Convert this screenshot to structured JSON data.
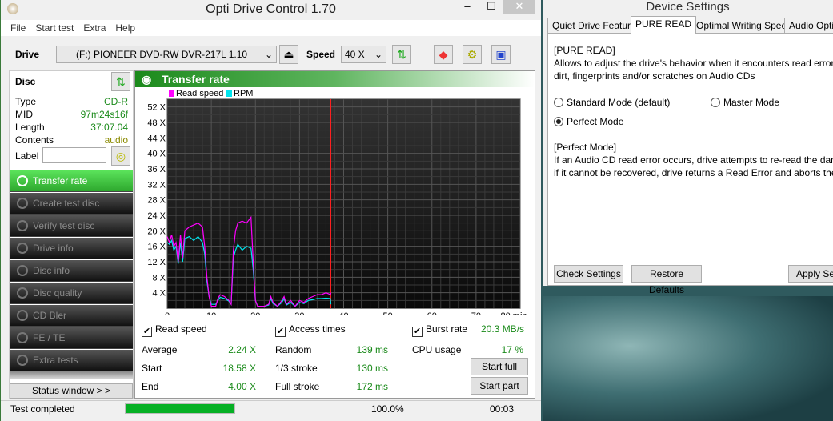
{
  "window": {
    "title": "Opti Drive Control 1.70",
    "minimize": "–",
    "maximize": "☐",
    "close": "✕"
  },
  "menu": [
    "File",
    "Start test",
    "Extra",
    "Help"
  ],
  "toolbar": {
    "drive_label": "Drive",
    "drive_value": "(F:)   PIONEER DVD-RW  DVR-217L 1.10",
    "speed_label": "Speed",
    "speed_value": "40 X"
  },
  "disc": {
    "title": "Disc",
    "fields": [
      {
        "k": "Type",
        "v": "CD-R"
      },
      {
        "k": "MID",
        "v": "97m24s16f"
      },
      {
        "k": "Length",
        "v": "37:07.04"
      },
      {
        "k": "Contents",
        "v": "audio"
      }
    ],
    "label_label": "Label",
    "label_value": ""
  },
  "nav": [
    "Transfer rate",
    "Create test disc",
    "Verify test disc",
    "Drive info",
    "Disc info",
    "Disc quality",
    "CD Bler",
    "FE / TE",
    "Extra tests"
  ],
  "status_window": "Status window > >",
  "panel_title": "Transfer rate",
  "chart_data": {
    "type": "line",
    "xlabel": "min",
    "xlim": [
      0,
      80
    ],
    "ylim": [
      0,
      54
    ],
    "xticks": [
      "0",
      "10",
      "20",
      "30",
      "40",
      "50",
      "60",
      "70",
      "80 min"
    ],
    "yticks": [
      "4 X",
      "8 X",
      "12 X",
      "16 X",
      "20 X",
      "24 X",
      "28 X",
      "32 X",
      "36 X",
      "40 X",
      "44 X",
      "48 X",
      "52 X"
    ],
    "grid": true,
    "legend": "top-left",
    "marker_line_x": 37.1,
    "colors": {
      "Read speed": "#ff00ff",
      "RPM": "#00e5ee",
      "marker": "#ff2020",
      "bg": "#1a1a1a"
    },
    "series": [
      {
        "name": "Read speed",
        "x": [
          0,
          0.5,
          1,
          1.5,
          2,
          2.5,
          3,
          3.5,
          4,
          5,
          6,
          7,
          8,
          8.5,
          9,
          9.5,
          10,
          11,
          11.5,
          12,
          13,
          14,
          14.5,
          15,
          15.5,
          16,
          17,
          18,
          19,
          19.5,
          20,
          20.5,
          22,
          23,
          23.5,
          24,
          25,
          26,
          26.5,
          27,
          28,
          29,
          30,
          31,
          32,
          33,
          34,
          35,
          36,
          37,
          37.1
        ],
        "values": [
          18.5,
          17,
          19,
          16,
          17,
          12,
          19,
          13,
          20,
          21,
          21.5,
          22,
          21,
          16,
          8,
          3,
          0.5,
          0.5,
          2.5,
          3.5,
          3,
          2,
          1,
          15,
          20,
          22,
          22.5,
          22,
          23.5,
          12,
          2,
          0.5,
          0.5,
          1,
          3,
          1.5,
          0.5,
          2,
          3,
          1,
          2,
          0.5,
          2,
          1.5,
          2.5,
          3,
          3.5,
          3.5,
          4,
          3.5,
          4
        ]
      },
      {
        "name": "RPM",
        "x": [
          0,
          0.5,
          1,
          1.5,
          2,
          2.5,
          3,
          3.5,
          4,
          5,
          6,
          7,
          8,
          8.5,
          9,
          9.5,
          10,
          11,
          11.5,
          12,
          13,
          14,
          14.5,
          15,
          15.5,
          16,
          17,
          18,
          19,
          19.5,
          20,
          20.5,
          22,
          23,
          23.5,
          24,
          25,
          26,
          26.5,
          27,
          28,
          29,
          30,
          31,
          32,
          33,
          34,
          35,
          36,
          37,
          37.1
        ],
        "values": [
          17,
          16.5,
          17.5,
          15,
          16,
          11.5,
          17,
          12,
          18,
          18.5,
          17.5,
          18.5,
          17,
          14,
          7,
          3,
          1,
          1,
          2,
          2.8,
          2.5,
          1.8,
          1,
          13,
          15,
          16.5,
          15,
          16,
          15.5,
          10,
          2,
          0.5,
          0.5,
          0.8,
          2.5,
          1.2,
          0.5,
          1.5,
          2.5,
          0.8,
          1.5,
          0.5,
          1.5,
          1.2,
          2,
          2.2,
          2.5,
          2.5,
          2.6,
          2.5,
          1
        ]
      }
    ]
  },
  "stats": {
    "read_speed_label": "Read speed",
    "access_label": "Access times",
    "burst_label": "Burst rate",
    "burst_value": "20.3 MB/s",
    "average_label": "Average",
    "average": "2.24 X",
    "start_label": "Start",
    "start": "18.58 X",
    "end_label": "End",
    "end": "4.00 X",
    "random_label": "Random",
    "random": "139 ms",
    "third_label": "1/3 stroke",
    "third": "130 ms",
    "full_label": "Full stroke",
    "full": "172 ms",
    "cpu_label": "CPU usage",
    "cpu": "17 %",
    "start_full": "Start full",
    "start_part": "Start part"
  },
  "status": {
    "text": "Test completed",
    "progress": 100,
    "progress_text": "100.0%",
    "time": "00:03"
  },
  "device_settings": {
    "title": "Device Settings",
    "tabs": [
      "Quiet Drive Feature",
      "PURE READ",
      "Optimal Writing Speed",
      "Audio Optim"
    ],
    "heading": "[PURE READ]",
    "desc1": "Allows to adjust the drive's behavior when it encounters read errors caused",
    "desc2": "dirt, fingerprints and/or scratches on Audio CDs",
    "modes": [
      {
        "label": "Standard Mode (default)",
        "selected": false
      },
      {
        "label": "Master Mode",
        "selected": false
      },
      {
        "label": "Perfect Mode",
        "selected": true
      }
    ],
    "mode_heading": "[Perfect Mode]",
    "mode_desc1": "If an Audio CD read error occurs, drive attempts to re-read the damaged se",
    "mode_desc2": "if it cannot be recovered, drive returns a Read Error and aborts the operatio",
    "check": "Check Settings",
    "restore": "Restore Defaults",
    "apply": "Apply Setti"
  }
}
